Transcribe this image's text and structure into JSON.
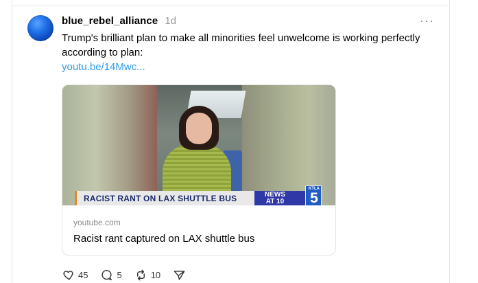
{
  "post": {
    "username": "blue_rebel_alliance",
    "time": "1d",
    "more_icon": "more-horizontal-icon",
    "text": "Trump's brilliant plan to make all minorities feel unwelcome is working perfectly according to plan:",
    "link": "youtu.be/14Mwc..."
  },
  "card": {
    "domain": "youtube.com",
    "title": "Racist rant captured on LAX shuttle bus",
    "thumbnail": {
      "chyron": "RACIST RANT ON LAX SHUTTLE BUS",
      "news_line1": "NEWS",
      "news_line2": "AT 10",
      "station_label": "KTLA",
      "station_number": "5"
    }
  },
  "actions": {
    "like_icon": "heart-icon",
    "like_count": "45",
    "reply_icon": "comment-icon",
    "reply_count": "5",
    "repost_icon": "repost-icon",
    "repost_count": "10",
    "share_icon": "send-icon"
  },
  "colors": {
    "link": "#2f9bed",
    "news_blue": "#2f38a7",
    "chyron_text": "#1a2a6b"
  }
}
